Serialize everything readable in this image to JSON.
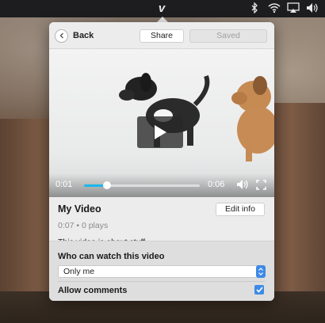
{
  "menubar": {
    "icons": [
      "vimeo-icon",
      "bluetooth-icon",
      "wifi-icon",
      "airplay-icon",
      "volume-icon"
    ],
    "vimeo_glyph": "v"
  },
  "toolbar": {
    "back_label": "Back",
    "share_label": "Share",
    "saved_label": "Saved"
  },
  "player": {
    "current_time": "0:01",
    "duration": "0:06",
    "progress": 0.2
  },
  "video": {
    "title": "My Video",
    "meta": "0:07 • 0 plays",
    "description": "This video is about stuff.",
    "edit_label": "Edit info"
  },
  "privacy": {
    "heading": "Who can watch this video",
    "selected": "Only me",
    "allow_comments_label": "Allow comments",
    "allow_comments": true
  },
  "colors": {
    "accent": "#3d8ae6",
    "progress": "#1ab7ea"
  }
}
